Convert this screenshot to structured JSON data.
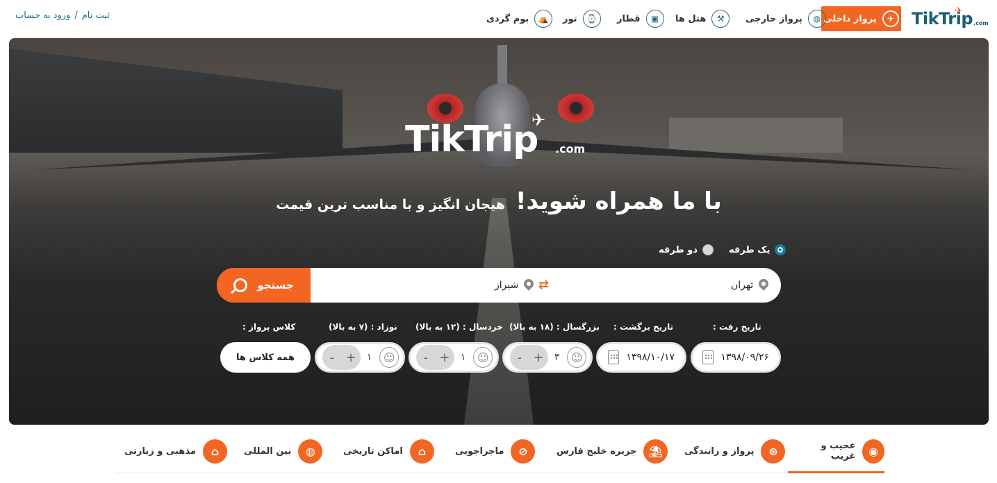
{
  "header": {
    "logo": {
      "name": "TikTrip",
      "suffix": ".com"
    },
    "nav": [
      {
        "label": "پرواز داخلی",
        "icon": "airplane-icon",
        "active": true
      },
      {
        "label": "پرواز خارجی",
        "icon": "globe-icon"
      },
      {
        "label": "هتل ها",
        "icon": "hotel-icon"
      },
      {
        "label": "قطار",
        "icon": "train-icon"
      },
      {
        "label": "تور",
        "icon": "tour-icon"
      },
      {
        "label": "بوم گردی",
        "icon": "eco-tent-icon"
      }
    ],
    "auth": {
      "register": "ثبت نام",
      "separator": "/",
      "login": "ورود به حساب"
    }
  },
  "hero": {
    "logo": {
      "name": "TikTrip",
      "suffix": ".com"
    },
    "slogan_big": "با ما همراه شوید!",
    "slogan_small": "هیجان انگیز و با مناسب ترین قیمت",
    "trip_types": [
      {
        "label": "یک طرفه",
        "selected": true
      },
      {
        "label": "دو طرفه",
        "selected": false
      }
    ],
    "search": {
      "origin": "تهران",
      "destination": "شیراز",
      "button_label": "جستجو"
    },
    "fields": {
      "depart_label": "تاریخ رفت :",
      "depart_value": "۱۳۹۸/۰۹/۲۶",
      "return_label": "تاریخ برگشت :",
      "return_value": "۱۳۹۸/۱۰/۱۷",
      "adult_label": "بزرگسال : (۱۸ به بالا)",
      "adult_value": "۳",
      "child_label": "خردسال : (۱۲ به بالا)",
      "child_value": "۱",
      "infant_label": "نوزاد : (۷ به بالا)",
      "infant_value": "۱",
      "class_label": "کلاس پرواز :",
      "class_value": "همه کلاس ها",
      "plus": "+",
      "minus": "-"
    }
  },
  "categories": [
    {
      "label": "عجیب و غریب",
      "icon": "eye-icon",
      "active": true
    },
    {
      "label": "پرواز و رانندگی",
      "icon": "steering-wheel-icon"
    },
    {
      "label": "جزیره خلیج فارس",
      "icon": "island-icon"
    },
    {
      "label": "ماجراجویی",
      "icon": "compass-icon"
    },
    {
      "label": "اماکن تاریخی",
      "icon": "column-icon"
    },
    {
      "label": "بین المللی",
      "icon": "globe-icon"
    },
    {
      "label": "مذهبی و زیارتی",
      "icon": "mosque-icon"
    }
  ],
  "colors": {
    "accent": "#f26522",
    "brand": "#1a5f74",
    "radio": "#0e7ca4"
  }
}
